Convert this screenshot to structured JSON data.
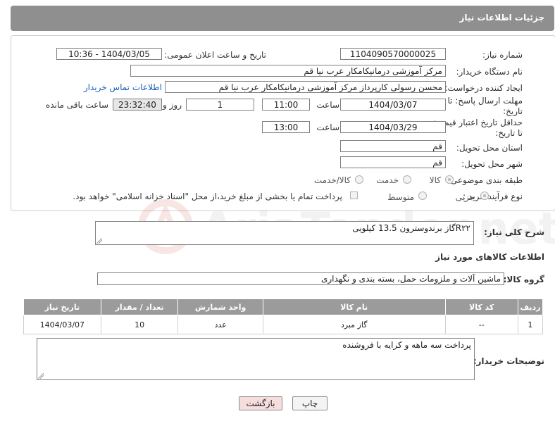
{
  "header": {
    "title": "جزئیات اطلاعات نیاز"
  },
  "form": {
    "need_number": {
      "label": "شماره نیاز:",
      "value": "1104090570000025"
    },
    "announce_datetime": {
      "label": "تاریخ و ساعت اعلان عمومی:",
      "value": "1404/03/05 - 10:36"
    },
    "buyer_org": {
      "label": "نام دستگاه خریدار:",
      "value": "مرکز آموزشی درمانیکامکار عرب نیا قم"
    },
    "requester": {
      "label": "ایجاد کننده درخواست:",
      "value": "محسن رسولی کارپرداز مرکز آموزشی درمانیکامکار عرب نیا قم",
      "contact_link": "اطلاعات تماس خریدار"
    },
    "reply_deadline": {
      "label_line1": "مهلت ارسال پاسخ: تا",
      "label_line2": "تاریخ:",
      "date": "1404/03/07",
      "time_label": "ساعت",
      "time": "11:00",
      "days": "1",
      "days_label": "روز و",
      "remaining": "23:32:40",
      "remaining_label": "ساعت باقی مانده"
    },
    "price_validity": {
      "label_line1": "حداقل تاریخ اعتبار قیمت:",
      "label_line2": "تا تاریخ:",
      "date": "1404/03/29",
      "time_label": "ساعت",
      "time": "13:00"
    },
    "province": {
      "label": "استان محل تحویل:",
      "value": "قم"
    },
    "city": {
      "label": "شهر محل تحویل:",
      "value": "قم"
    },
    "category": {
      "label": "طبقه بندی موضوعی:",
      "options": [
        "کالا",
        "خدمت",
        "کالا/خدمت"
      ],
      "selected": "کالا"
    },
    "process": {
      "label": "نوع فرآیند خرید :",
      "options": [
        "جزیی",
        "متوسط"
      ],
      "selected": "جزیی",
      "payment_note": "پرداخت تمام یا بخشی از مبلغ خرید،از محل \"اسناد خزانه اسلامی\" خواهد بود."
    }
  },
  "description": {
    "label": "شرح کلی نیاز:",
    "value": "R۲۲گاز    برندوسترون 13.5 کیلویی"
  },
  "goods_info": {
    "title": "اطلاعات کالاهای مورد نیاز"
  },
  "goods_group": {
    "label": "گروه کالا:",
    "value": "ماشین آلات و ملزومات حمل، بسته بندی و نگهداری"
  },
  "table": {
    "headers": [
      "ردیف",
      "کد کالا",
      "نام کالا",
      "واحد شمارش",
      "تعداد / مقدار",
      "تاریخ نیاز"
    ],
    "rows": [
      {
        "row": "1",
        "code": "--",
        "name": "گاز مبرد",
        "unit": "عدد",
        "qty": "10",
        "date": "1404/03/07"
      }
    ]
  },
  "buyer_notes": {
    "label": "توضیحات خریدار:",
    "value": "پرداخت سه ماهه و کرایه با فروشنده"
  },
  "buttons": {
    "print": "چاپ",
    "back": "بازگشت"
  },
  "watermark": {
    "text": "AriaTender.net"
  },
  "colors": {
    "header_bg": "#8f8f8f",
    "table_header_bg": "#9b9b9b",
    "link": "#1a5fb4",
    "back_button_bg": "#f7dede"
  }
}
